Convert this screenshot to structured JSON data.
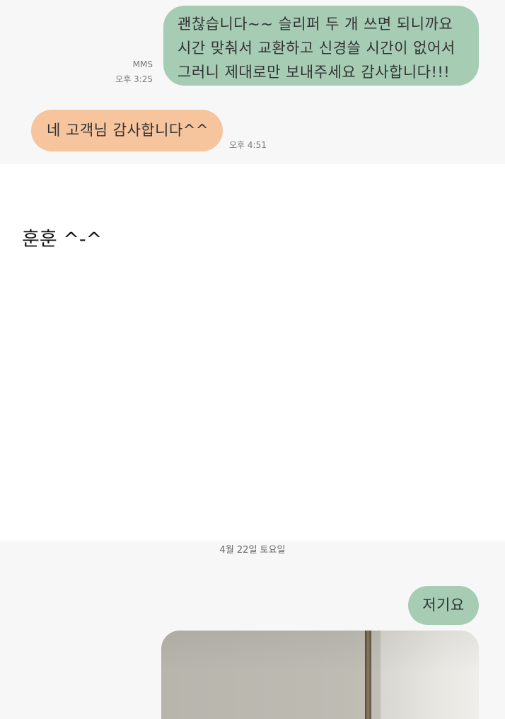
{
  "conversation": {
    "messages": [
      {
        "direction": "outgoing",
        "text": "괜찮습니다~~ 슬리퍼 두 개 쓰면 되니까요\n시간 맞춰서 교환하고 신경쓸 시간이 없어서\n그러니 제대로만 보내주세요 감사합니다!!!",
        "type_label": "MMS",
        "time": "오후 3:25"
      },
      {
        "direction": "incoming",
        "text": "네 고객님 감사합니다^^",
        "time": "오후 4:51"
      }
    ],
    "date_divider": "4월 22일 토요일",
    "later_messages": [
      {
        "direction": "outgoing",
        "text": "저기요"
      }
    ]
  },
  "caption": {
    "text": "훈훈 ^-^"
  },
  "colors": {
    "outgoing_bubble": "#a6ccb4",
    "incoming_bubble": "#f6c49d",
    "chat_background": "#f7f7f7",
    "page_background": "#ffffff"
  }
}
